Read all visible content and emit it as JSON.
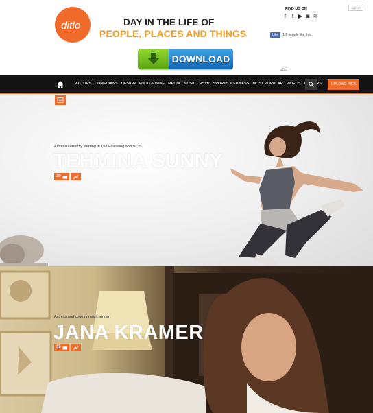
{
  "header": {
    "logo_text": "ditlo",
    "tagline_line1": "DAY IN THE LIFE OF",
    "tagline_line2": "PEOPLE, PLACES AND THINGS",
    "download_label": "DOWNLOAD",
    "find_us_label": "FIND US ON",
    "signin_label": "sign in",
    "fb_like_label": "Like",
    "fb_like_text": "1.2 people like this.",
    "pzip_label": "pZip"
  },
  "nav": {
    "items": [
      "ACTORS",
      "COMEDIANS",
      "DESIGN",
      "FOOD & WINE",
      "MEDIA",
      "MUSIC",
      "RSVP",
      "SPORTS & FITNESS",
      "MOST POPULAR",
      "VIDEOS",
      "WRITERS"
    ],
    "upload_label": "UPLOAD PICS"
  },
  "features": [
    {
      "caption": "Actress currently starring in The Following and NCIS.",
      "name": "TEHMINA SUNNY",
      "photo_count": "20"
    },
    {
      "caption": "Actress and country music singer.",
      "name": "JANA KRAMER",
      "photo_count": "35"
    }
  ],
  "colors": {
    "accent": "#f06a2a",
    "tagline_orange": "#f39a1c",
    "nav_bg": "#141414"
  }
}
